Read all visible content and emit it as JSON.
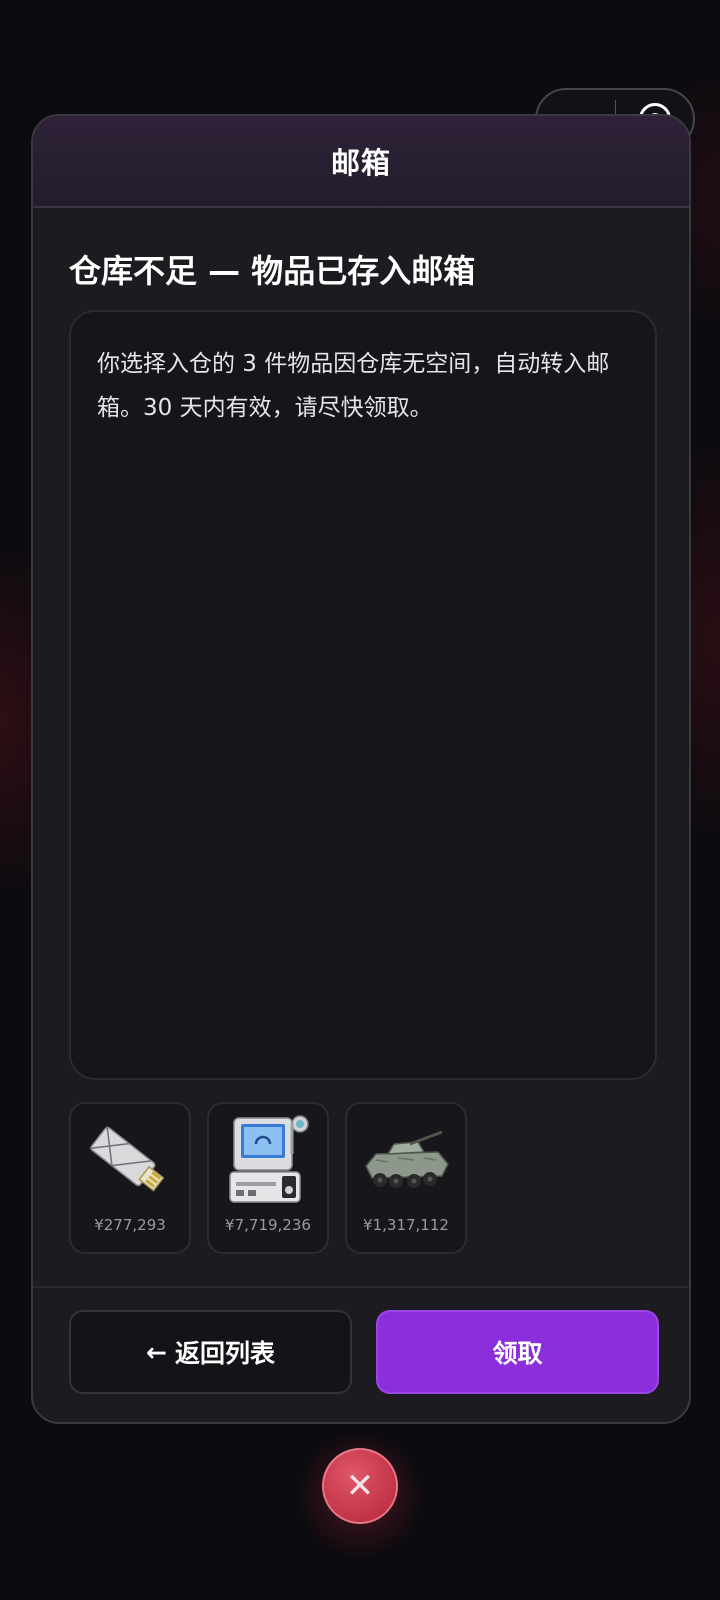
{
  "capsule": {
    "more_icon": "more-dots-icon",
    "close_icon": "target-circle-icon"
  },
  "modal": {
    "title": "邮箱",
    "subject": "仓库不足 — 物品已存入邮箱",
    "body": "你选择入仓的 3 件物品因仓库无空间，自动转入邮箱。30 天内有效，请尽快领取。",
    "items": [
      {
        "icon": "usb-drive-icon",
        "price": "¥277,293"
      },
      {
        "icon": "medical-device-icon",
        "price": "¥7,719,236"
      },
      {
        "icon": "armored-vehicle-icon",
        "price": "¥1,317,112"
      }
    ],
    "buttons": {
      "back_arrow": "←",
      "back_label": "返回列表",
      "claim_label": "领取"
    }
  },
  "close_button": {
    "glyph": "✕",
    "icon": "close-icon"
  },
  "colors": {
    "accent": "#8b2edb",
    "close": "#c23347",
    "panel": "#1c1b20"
  }
}
